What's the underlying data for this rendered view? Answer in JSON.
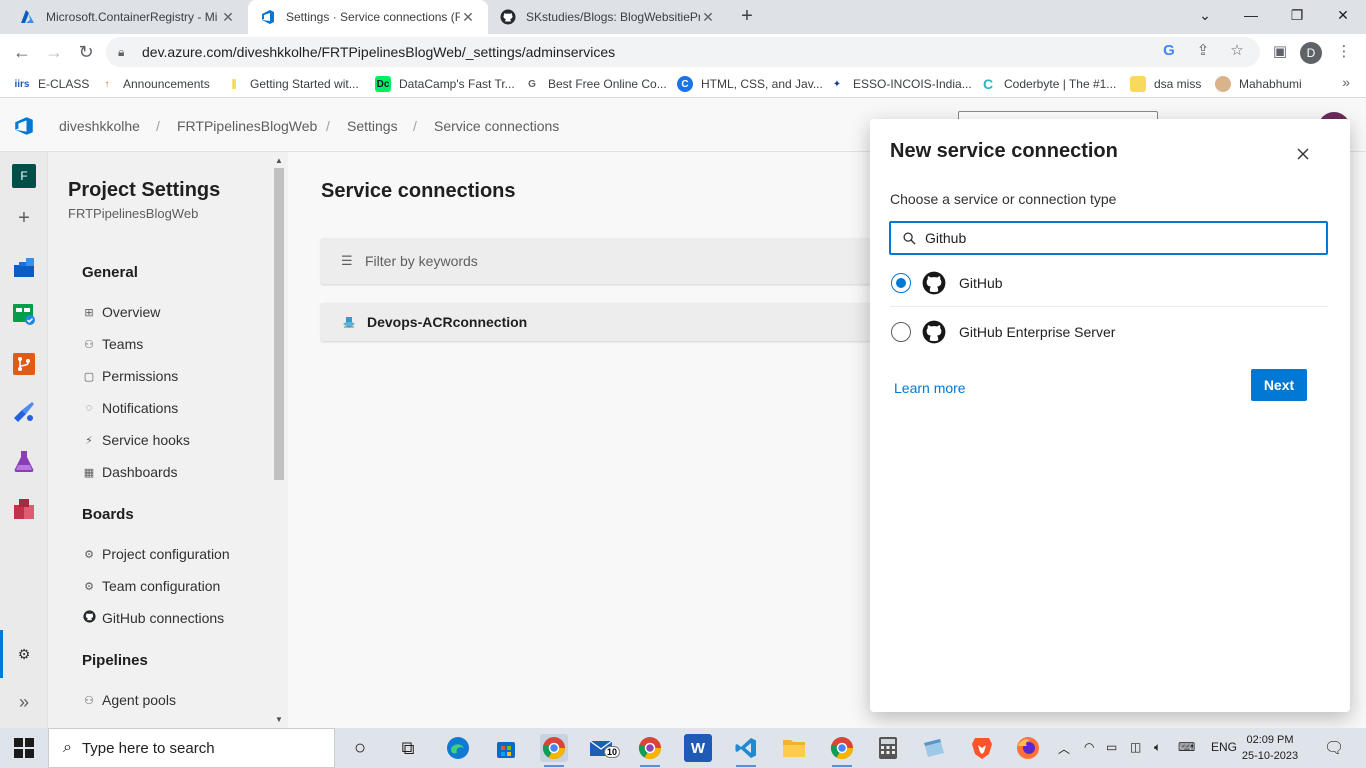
{
  "browser": {
    "tabs": [
      {
        "title": "Microsoft.ContainerRegistry - Mi",
        "icon": "azure-icon",
        "active": false
      },
      {
        "title": "Settings · Service connections (F",
        "icon": "azure-devops-icon",
        "active": true
      },
      {
        "title": "SKstudies/Blogs: BlogWebsitiePr",
        "icon": "github-icon",
        "active": false
      }
    ],
    "url": "dev.azure.com/diveshkkolhe/FRTPipelinesBlogWeb/_settings/adminservices",
    "profile_initial": "D",
    "bookmarks": [
      {
        "label": "E-CLASS",
        "icon": "iirs-icon",
        "color": "#1a5fb4"
      },
      {
        "label": "Announcements",
        "icon": "flame-icon",
        "color": "#e66100"
      },
      {
        "label": "Getting Started wit...",
        "icon": "bars-icon",
        "color": "#f6c000"
      },
      {
        "label": "DataCamp's Fast Tr...",
        "icon": "datacamp-icon",
        "color": "#03ef62"
      },
      {
        "label": "Best Free Online Co...",
        "icon": "g-icon",
        "color": "#5f6368"
      },
      {
        "label": "HTML, CSS, and Jav...",
        "icon": "c-circle-icon",
        "color": "#1a73e8"
      },
      {
        "label": "ESSO-INCOIS-India...",
        "icon": "incois-icon",
        "color": "#1c3f94"
      },
      {
        "label": "Coderbyte | The #1...",
        "icon": "coderbyte-icon",
        "color": "#2bb3c0"
      },
      {
        "label": "dsa miss",
        "icon": "folder-icon",
        "color": "#f9d95c"
      },
      {
        "label": "Mahabhumi",
        "icon": "mahabhumi-icon",
        "color": "#8b5a2b"
      }
    ]
  },
  "header": {
    "breadcrumbs": [
      "diveshkkolhe",
      "FRTPipelinesBlogWeb",
      "Settings",
      "Service connections"
    ]
  },
  "sidebar": {
    "title": "Project Settings",
    "subtitle": "FRTPipelinesBlogWeb",
    "groups": [
      {
        "label": "General",
        "items": [
          {
            "label": "Overview",
            "icon": "overview-icon"
          },
          {
            "label": "Teams",
            "icon": "teams-icon"
          },
          {
            "label": "Permissions",
            "icon": "lock-icon"
          },
          {
            "label": "Notifications",
            "icon": "notification-icon"
          },
          {
            "label": "Service hooks",
            "icon": "service-hooks-icon"
          },
          {
            "label": "Dashboards",
            "icon": "dashboard-icon"
          }
        ]
      },
      {
        "label": "Boards",
        "items": [
          {
            "label": "Project configuration",
            "icon": "project-config-icon"
          },
          {
            "label": "Team configuration",
            "icon": "team-config-icon"
          },
          {
            "label": "GitHub connections",
            "icon": "github-icon"
          }
        ]
      },
      {
        "label": "Pipelines",
        "items": [
          {
            "label": "Agent pools",
            "icon": "agent-pools-icon"
          }
        ]
      }
    ],
    "project_letter": "F"
  },
  "main": {
    "title": "Service connections",
    "filter_placeholder": "Filter by keywords",
    "connections": [
      {
        "name": "Devops-ACRconnection",
        "icon": "container-registry-icon"
      }
    ]
  },
  "panel": {
    "title": "New service connection",
    "label": "Choose a service or connection type",
    "search_value": "Github",
    "options": [
      {
        "label": "GitHub",
        "selected": true,
        "icon": "github-icon"
      },
      {
        "label": "GitHub Enterprise Server",
        "selected": false,
        "icon": "github-icon"
      }
    ],
    "learn_more": "Learn more",
    "next": "Next"
  },
  "taskbar": {
    "search_placeholder": "Type here to search",
    "mail_badge": "10",
    "language": "ENG",
    "time": "02:09 PM",
    "date": "25-10-2023"
  },
  "colors": {
    "accent": "#0078d4",
    "avatar": "#6b2a5c"
  }
}
